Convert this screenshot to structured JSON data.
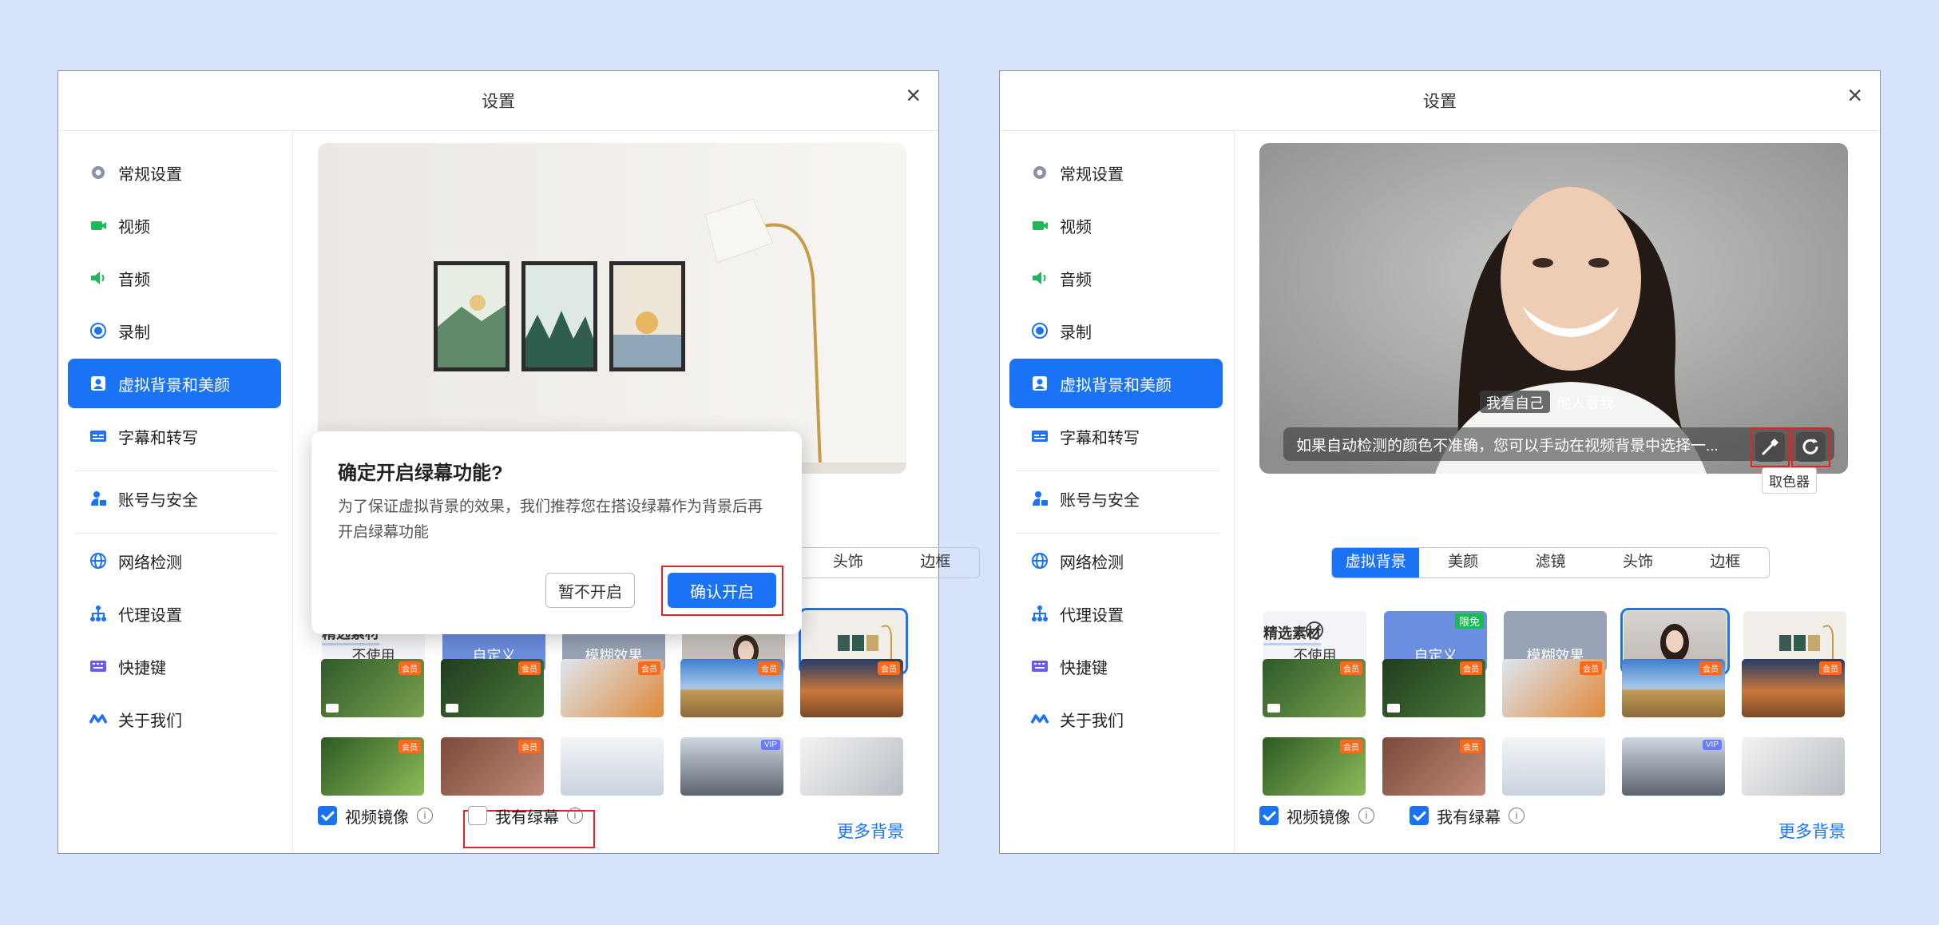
{
  "window_title": "设置",
  "close_symbol": "×",
  "nav": [
    "常规设置",
    "视频",
    "音频",
    "录制",
    "虚拟背景和美颜",
    "字幕和转写",
    "账号与安全",
    "网络检测",
    "代理设置",
    "快捷键",
    "关于我们"
  ],
  "tabs": [
    "虚拟背景",
    "美颜",
    "滤镜",
    "头饰",
    "边框"
  ],
  "bg_options": {
    "none": "不使用",
    "custom": "自定义",
    "blur": "模糊效果",
    "free_badge": "限免"
  },
  "section_title": "精选素材",
  "badge_label": "会员",
  "vip_label": "VIP",
  "mirror_label": "视频镜像",
  "greenscreen_label": "我有绿幕",
  "more_bg": "更多背景",
  "dialog": {
    "title": "确定开启绿幕功能?",
    "body": "为了保证虚拟背景的效果，我们推荐您在搭设绿幕作为背景后再开启绿幕功能",
    "cancel": "暂不开启",
    "confirm": "确认开启"
  },
  "preview2": {
    "self_view": "我看自己",
    "others_view": "他人看我",
    "hint": "如果自动检测的颜色不准确，您可以手动在视频背景中选择一...",
    "tooltip": "取色器"
  },
  "colors": {
    "accent": "#1a73f5",
    "highlight": "#e32222",
    "page_bg": "#d7e2fb"
  }
}
